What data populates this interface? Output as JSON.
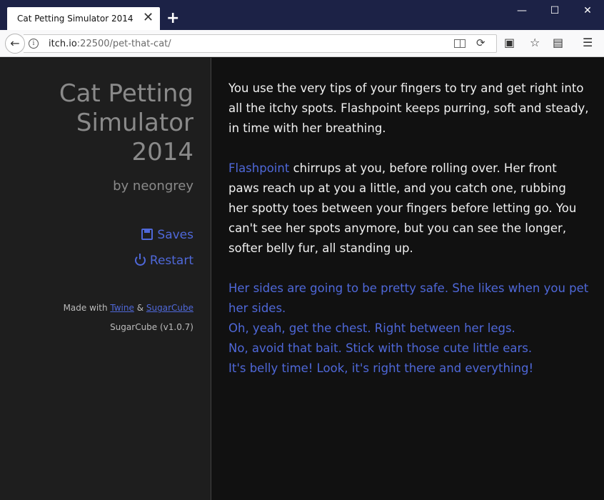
{
  "browser": {
    "tab_title": "Cat Petting Simulator 2014",
    "tab_close": "✕",
    "new_tab": "+",
    "url_host": "itch.io",
    "url_rest": ":22500/pet-that-cat/",
    "window_controls": {
      "minimize": "—",
      "maximize": "☐",
      "close": "✕"
    },
    "toolbar_icons": [
      "reader-view-icon",
      "reload-icon",
      "extension-icon",
      "bookmark-star-icon",
      "reading-list-icon",
      "hamburger-menu-icon"
    ]
  },
  "sidebar": {
    "title": "Cat Petting Simulator 2014",
    "author": "by neongrey",
    "menu": {
      "saves": "Saves",
      "restart": "Restart"
    },
    "credits": {
      "made_with": "Made with",
      "twine": "Twine",
      "amp": "&",
      "sugarcube": "SugarCube"
    },
    "version": "SugarCube (v1.0.7)"
  },
  "passage": {
    "p1": "You use the very tips of your fingers to try and get right into all the itchy spots. Flashpoint keeps purring, soft and steady, in time with her breathing.",
    "p2_link": "Flashpoint",
    "p2_text": " chirrups at you, before rolling over. Her front paws reach up at you a little, and you catch one, rubbing her spotty toes between your fingers before letting go. You can't see her spots anymore, but you can see the longer, softer belly fur, all standing up.",
    "choices": [
      "Her sides are going to be pretty safe. She likes when you pet her sides.",
      "Oh, yeah, get the chest. Right between her legs.",
      "No, avoid that bait. Stick with those cute little ears.",
      "It's belly time! Look, it's right there and everything!"
    ]
  },
  "colors": {
    "accent": "#4f68d9",
    "sidebar_bg": "#1e1e1e",
    "main_bg": "#111111",
    "titlebar": "#1c2246"
  }
}
